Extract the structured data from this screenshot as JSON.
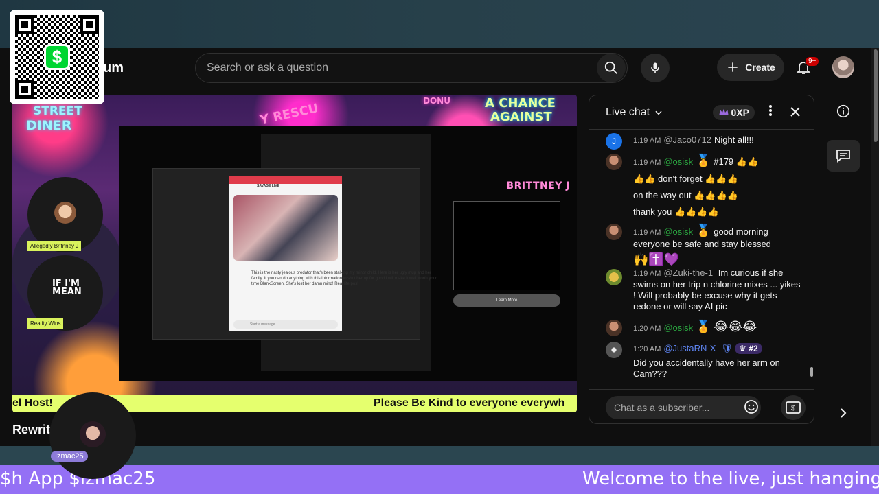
{
  "app": {
    "logo_partial": "um",
    "search_placeholder": "Search or ask a question",
    "create_label": "Create",
    "notification_count": "9+"
  },
  "video": {
    "signs": {
      "street": "STREET",
      "diner": "DINER",
      "rescue": "Y RESCU",
      "chance": "A CHANCE",
      "against": "AGAINST",
      "donut": "DONU"
    },
    "brand_tag": "BRITTNEY J",
    "guests": [
      {
        "label": "Allegedly Britnney J"
      },
      {
        "label": "Reality Wins",
        "caption": "IF I'M MEAN"
      }
    ],
    "ticker_left": "el Host!",
    "ticker_right": "Please Be Kind to everyone everywh",
    "inner_message": "This is the nasty jealous predator that's been stalking my minor child. Here is her ugly mug and her family. If you can do anything with this information to shut her up for good I will make it well worth your time BlankScreen. She's lost her damn mind! Real life pos!",
    "inner_card_title": "SAVAGE LIVE",
    "inner_input_placeholder": "Start a message",
    "learn_more": "Learn More"
  },
  "video_title": "Rewrit",
  "host": {
    "label": "Izmac25"
  },
  "chat": {
    "title": "Live chat",
    "xp": "0XP",
    "input_placeholder": "Chat as a subscriber...",
    "messages": [
      {
        "time": "1:19 AM",
        "author": "@Jaco0712",
        "text": "Night all!!!",
        "avatar_letter": "J",
        "avatar_color": "#1a73e8"
      },
      {
        "time": "1:19 AM",
        "author": "@osisk",
        "line1": "#179 👍👍",
        "line2": "👍👍 don't forget 👍👍👍",
        "line3": "on the way out 👍👍👍👍",
        "line4": "thank you 👍👍👍👍"
      },
      {
        "time": "1:19 AM",
        "author": "@osisk",
        "text": "good morning everyone be safe and stay blessed",
        "emojis": "🙌✝️💜"
      },
      {
        "time": "1:19 AM",
        "author": "@Zuki-the-1",
        "text": "Im curious if she swims on her trip n chlorine mixes ... yikes ! Will probably be excuse why it gets redone or will say AI pic"
      },
      {
        "time": "1:20 AM",
        "author": "@osisk",
        "emojis": "😂😂😂"
      },
      {
        "time": "1:20 AM",
        "author": "@JustaRN-X",
        "rank": "#2",
        "text": "Did you accidentally have her arm on Cam???"
      }
    ]
  },
  "bottom_ticker": {
    "left": "$h App $izmac25",
    "right": "Welcome to the live, just hanging out"
  },
  "colors": {
    "ticker_purple": "#9470f5",
    "ticker_green": "#e5ff6e",
    "chat_author_green": "#2ba640",
    "notify_red": "#cc0000"
  }
}
